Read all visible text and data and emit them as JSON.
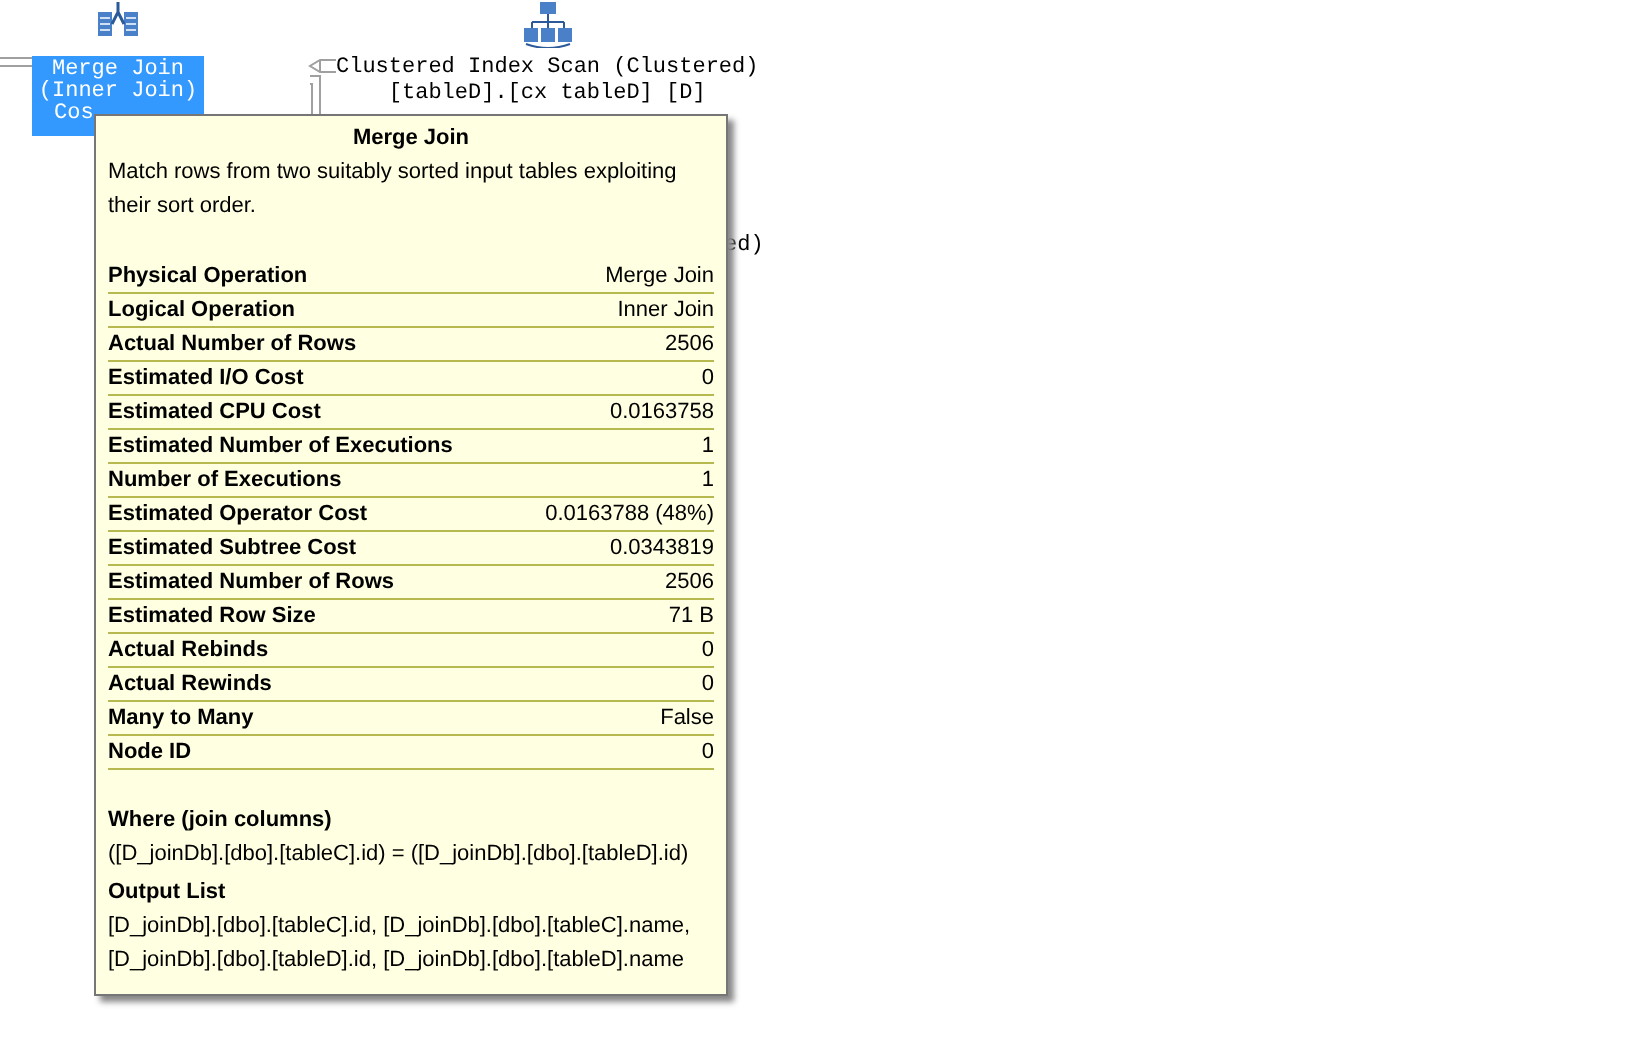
{
  "plan": {
    "nodes": [
      {
        "kind": "join",
        "lines": [
          "Merge Join",
          "(Inner Join)",
          "Cos"
        ],
        "selected": true
      },
      {
        "kind": "scan",
        "lines": [
          "Clustered Index Scan (Clustered)",
          "[tableD].[cx tableD] [D]"
        ],
        "selected": false
      }
    ],
    "partial_text": "ed)"
  },
  "tooltip": {
    "title": "Merge Join",
    "description": "Match rows from two suitably sorted input tables exploiting their sort order.",
    "properties": [
      {
        "name": "Physical Operation",
        "value": "Merge Join"
      },
      {
        "name": "Logical Operation",
        "value": "Inner Join"
      },
      {
        "name": "Actual Number of Rows",
        "value": "2506"
      },
      {
        "name": "Estimated I/O Cost",
        "value": "0"
      },
      {
        "name": "Estimated CPU Cost",
        "value": "0.0163758"
      },
      {
        "name": "Estimated Number of Executions",
        "value": "1"
      },
      {
        "name": "Number of Executions",
        "value": "1"
      },
      {
        "name": "Estimated Operator Cost",
        "value": "0.0163788 (48%)"
      },
      {
        "name": "Estimated Subtree Cost",
        "value": "0.0343819"
      },
      {
        "name": "Estimated Number of Rows",
        "value": "2506"
      },
      {
        "name": "Estimated Row Size",
        "value": "71 B"
      },
      {
        "name": "Actual Rebinds",
        "value": "0"
      },
      {
        "name": "Actual Rewinds",
        "value": "0"
      },
      {
        "name": "Many to Many",
        "value": "False"
      },
      {
        "name": "Node ID",
        "value": "0"
      }
    ],
    "sections": [
      {
        "heading": "Where (join columns)",
        "text": "([D_joinDb].[dbo].[tableC].id) = ([D_joinDb].[dbo].[tableD].id)"
      },
      {
        "heading": "Output List",
        "text": "[D_joinDb].[dbo].[tableC].id, [D_joinDb].[dbo].[tableC].name, [D_joinDb].[dbo].[tableD].id, [D_joinDb].[dbo].[tableD].name"
      }
    ]
  }
}
